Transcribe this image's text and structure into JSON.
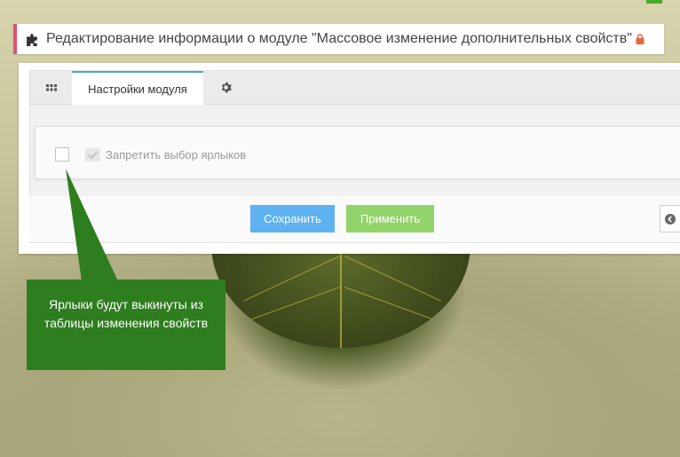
{
  "header": {
    "title": "Редактирование информации о модуле \"Массовое изменение дополнительных свойств\"",
    "icon": "puzzle-icon",
    "lock_icon": "lock-icon",
    "accent_color": "#e0516e"
  },
  "tabs": [
    {
      "icon": "grid-icon"
    },
    {
      "label": "Настройки модуля",
      "active": true
    },
    {
      "icon": "gear-icon"
    }
  ],
  "form": {
    "checkbox_label": "Запретить выбор ярлыков",
    "checked": false
  },
  "buttons": {
    "save_label": "Сохранить",
    "apply_label": "Применить",
    "back_icon": "back-arrow-icon"
  },
  "tooltip": {
    "text": "Ярлыки будут выкинуты из таблицы изменения свойств",
    "color": "#2e7d1e"
  }
}
